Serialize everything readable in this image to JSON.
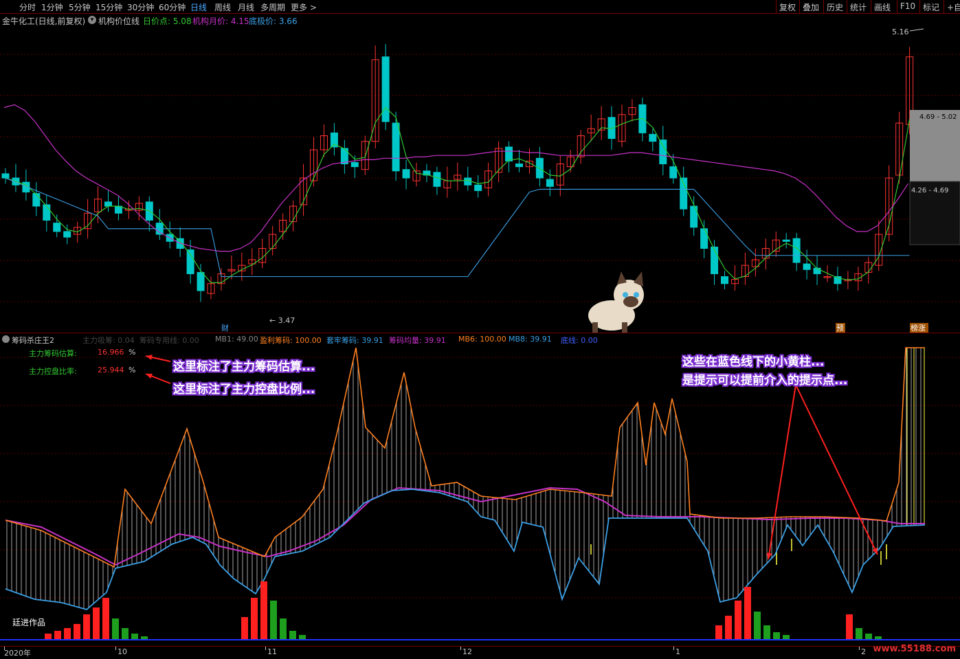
{
  "toolbar": {
    "periods": [
      "分时",
      "1分钟",
      "5分钟",
      "15分钟",
      "30分钟",
      "60分钟",
      "日线",
      "周线",
      "月线",
      "多周期",
      "更多 >"
    ],
    "active_period": "日线",
    "tools": [
      "复权",
      "叠加",
      "历史",
      "统计",
      "画线",
      "F10",
      "标记",
      "+自选"
    ]
  },
  "info": {
    "stock": "金牛化工(日线,前复权)",
    "indicator_icon": "settings-circle-icon",
    "indicator_name": "机构价位线",
    "daily_label": "日价点: 5.08",
    "cost_label": "机构月价: 4.15",
    "bottom_label": "底极价: 3.66"
  },
  "main": {
    "price_high_label": "5.16",
    "price_low_label": "3.47",
    "band_upper": "4.69 - 5.02",
    "band_lower": "4.26 - 4.69",
    "marker_cai": "财",
    "marker_yu": "预",
    "marker_bang": "榜涨"
  },
  "sub": {
    "title": "筹码杀庄王2",
    "faded_labels": [
      "主力吸筹: 0.04",
      "筹码专用线: 0.00"
    ],
    "mb1": "MB1: 49.00",
    "profit": "盈利筹码: 100.00",
    "trapped": "套牢筹码: 39.91",
    "avg": "筹码均量: 39.91",
    "mb6": "MB6: 100.00",
    "mb8": "MB8: 39.91",
    "bottom": "底线: 0.00",
    "est_chip_label": "主力筹码估算:",
    "est_chip_value": "16.966",
    "est_ctrl_label": "主力控盘比率:",
    "est_ctrl_value": "25.944",
    "pct": "%",
    "author": "廷进作品"
  },
  "callouts": {
    "c1": "这里标注了主力筹码估算...",
    "c2": "这里标注了主力控盘比例...",
    "c3_line1": "这些在蓝色线下的小黄柱...",
    "c3_line2": "是提示可以提前介入的提示点..."
  },
  "axis": {
    "labels": [
      "2020年",
      "10",
      "11",
      "12",
      "1",
      "2"
    ]
  },
  "site_watermark": "www.55188.com",
  "colors": {
    "up": "#ff3232",
    "down": "#00c8c8",
    "ma_green": "#32c832",
    "ma_magenta": "#c832c8",
    "ma_blue": "#3ca0e6",
    "orange": "#ff8020",
    "yellow": "#ffff40"
  },
  "chart_data": [
    {
      "type": "candlestick",
      "title": "金牛化工(日线,前复权)",
      "annotations": [
        "5.16",
        "3.47",
        "4.69 - 5.02",
        "4.26 - 4.69"
      ],
      "close_series_approx": [
        4.3,
        4.25,
        4.2,
        4.1,
        4.0,
        3.92,
        3.88,
        3.95,
        4.05,
        4.15,
        4.1,
        4.05,
        4.08,
        4.12,
        4.0,
        3.9,
        3.85,
        3.8,
        3.62,
        3.5,
        3.55,
        3.62,
        3.65,
        3.68,
        3.72,
        3.8,
        3.9,
        4.0,
        4.1,
        4.3,
        4.5,
        4.6,
        4.52,
        4.4,
        4.38,
        4.56,
        5.14,
        4.7,
        4.35,
        4.3,
        4.35,
        4.32,
        4.24,
        4.28,
        4.32,
        4.25,
        4.21,
        4.35,
        4.51,
        4.42,
        4.38,
        4.42,
        4.3,
        4.24,
        4.4,
        4.45,
        4.6,
        4.65,
        4.72,
        4.58,
        4.75,
        4.8,
        4.62,
        4.56,
        4.4,
        4.3,
        4.08,
        3.95,
        3.8,
        3.62,
        3.55,
        3.58,
        3.68,
        3.72,
        3.8,
        3.86,
        3.85,
        3.7,
        3.65,
        3.62,
        3.6,
        3.55,
        3.58,
        3.62,
        3.7,
        3.9,
        4.3,
        4.69,
        5.16
      ]
    },
    {
      "type": "line",
      "title": "筹码杀庄王2",
      "series": [
        {
          "name": "盈利筹码",
          "color": "#ff8020"
        },
        {
          "name": "套牢筹码",
          "color": "#3ca0e6"
        },
        {
          "name": "筹码均量",
          "color": "#c832c8"
        }
      ]
    }
  ]
}
